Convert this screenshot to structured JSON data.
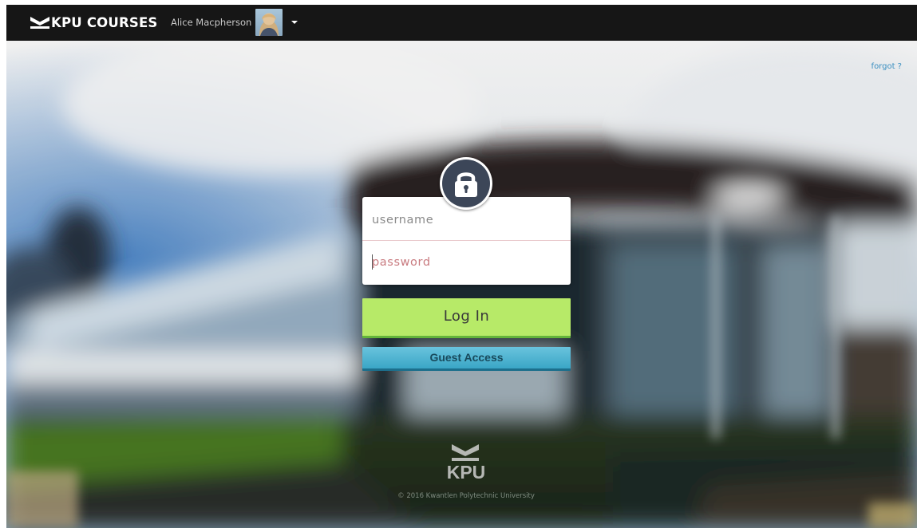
{
  "header": {
    "brand_label": "KPU COURSES",
    "brand_icon": "kpu-chevron-logo",
    "user_name": "Alice Macpherson",
    "avatar_icon": "user-avatar",
    "menu_icon": "caret-down-icon"
  },
  "login": {
    "lock_icon": "lock-icon",
    "username_placeholder": "username",
    "password_placeholder": "password",
    "forgot_label": "forgot ?",
    "login_label": "Log In",
    "guest_label": "Guest Access"
  },
  "footer": {
    "logo_text": "KPU",
    "copyright": "© 2016 Kwantlen Polytechnic University"
  },
  "colors": {
    "navbar": "#161616",
    "login_button": "#b7ea68",
    "login_button_border": "#63b43a",
    "guest_button": "#3aa6c6",
    "lock_badge": "#3c4658",
    "forgot_link": "#3a8fc0"
  }
}
